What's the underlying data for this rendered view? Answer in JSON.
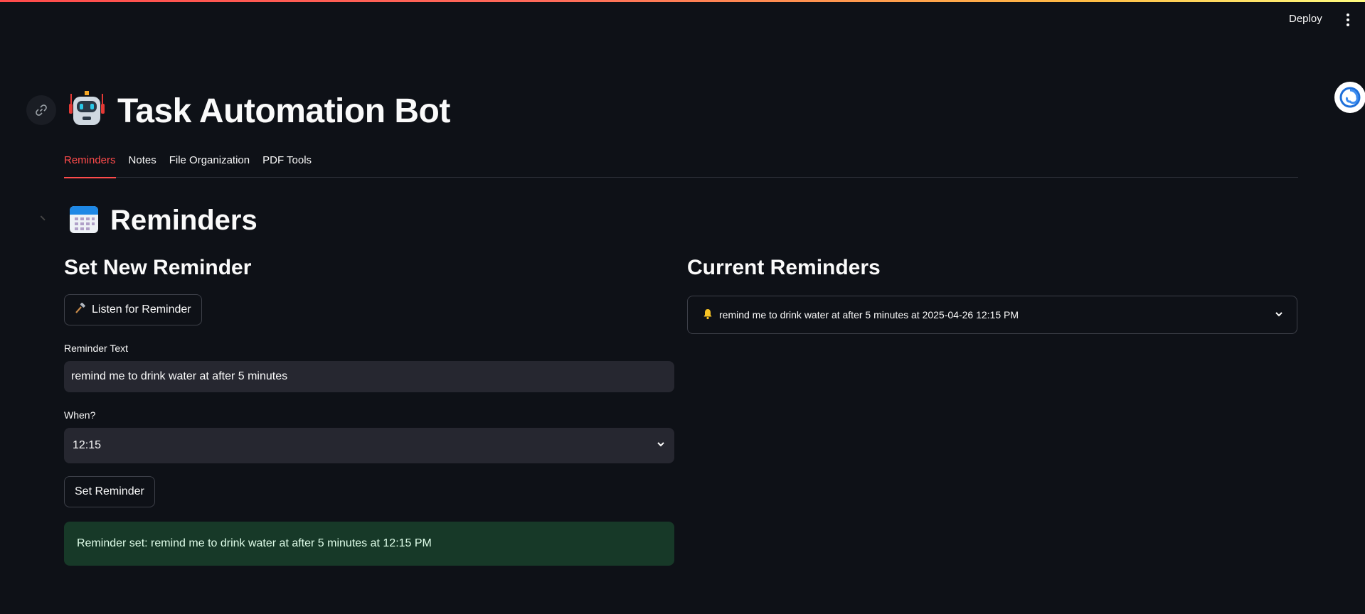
{
  "header": {
    "deploy_label": "Deploy",
    "menu_icon": "kebab-menu-icon"
  },
  "app": {
    "title": "Task Automation Bot",
    "title_icon": "robot-icon"
  },
  "tabs": [
    {
      "label": "Reminders",
      "active": true
    },
    {
      "label": "Notes",
      "active": false
    },
    {
      "label": "File Organization",
      "active": false
    },
    {
      "label": "PDF Tools",
      "active": false
    }
  ],
  "section": {
    "title": "Reminders",
    "icon": "calendar-icon"
  },
  "left": {
    "heading": "Set New Reminder",
    "listen_button": "Listen for Reminder",
    "reminder_text_label": "Reminder Text",
    "reminder_text_value": "remind me to drink water at after 5 minutes",
    "when_label": "When?",
    "when_value": "12:15",
    "set_button": "Set Reminder",
    "success_message": "Reminder set: remind me to drink water at after 5 minutes at 12:15 PM"
  },
  "right": {
    "heading": "Current Reminders",
    "reminders": [
      {
        "text": "remind me to drink water at after 5 minutes at 2025-04-26 12:15 PM"
      }
    ]
  },
  "colors": {
    "accent": "#ff4b4b",
    "background": "#0e1117",
    "input_bg": "#262730",
    "success_bg": "#173928"
  }
}
